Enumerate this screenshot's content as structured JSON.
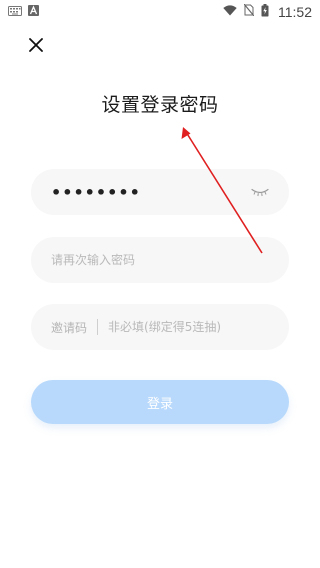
{
  "status_bar": {
    "time": "11:52",
    "left_icons": [
      "keyboard-icon",
      "font-a-icon"
    ],
    "right_icons": [
      "wifi-icon",
      "no-sim-icon",
      "battery-charging-icon"
    ]
  },
  "header": {
    "close_icon": "close-icon",
    "title": "设置登录密码"
  },
  "form": {
    "password": {
      "value": "••••••••",
      "toggle_icon": "eye-closed-icon"
    },
    "confirm_password": {
      "value": "",
      "placeholder": "请再次输入密码"
    },
    "invite_code": {
      "label": "邀请码",
      "value": "",
      "placeholder": "非必填(绑定得5连抽)"
    },
    "submit_label": "登录"
  },
  "colors": {
    "accent_button": "#b8d9fb",
    "field_background": "#f7f7f7",
    "annotation_arrow": "#e02020"
  }
}
